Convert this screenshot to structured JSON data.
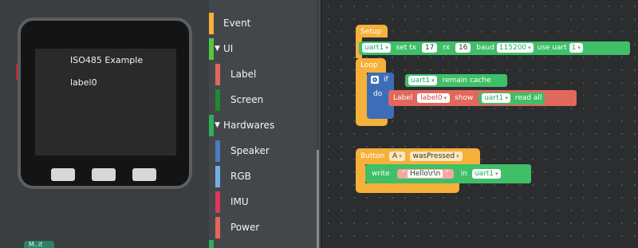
{
  "device": {
    "screen_title": "ISO485 Example",
    "screen_label": "label0",
    "partial_tab_label": "M..it"
  },
  "menu": {
    "items": [
      {
        "label": "Event",
        "color": "#f6b13a"
      },
      {
        "label": "UI",
        "color": "#55c83d",
        "expanded": true
      },
      {
        "label": "Label",
        "color": "#e2685c"
      },
      {
        "label": "Screen",
        "color": "#1f8a2f"
      },
      {
        "label": "Hardwares",
        "color": "#2fae5a",
        "expanded": true
      },
      {
        "label": "Speaker",
        "color": "#4f7ac4"
      },
      {
        "label": "RGB",
        "color": "#6fb1e6"
      },
      {
        "label": "IMU",
        "color": "#e0365f"
      },
      {
        "label": "Power",
        "color": "#e2685c"
      }
    ],
    "expand_glyph": "▼"
  },
  "workspace": {
    "setup": {
      "header": "Setup",
      "uart_var": "uart1",
      "set_tx": "set tx",
      "tx": "17",
      "rx_label": "rx",
      "rx": "16",
      "baud_label": "baud",
      "baud": "115200",
      "use_uart": "use uart",
      "uart_num": "1"
    },
    "loop": {
      "header": "Loop",
      "if_label": "if",
      "uart_var": "uart1",
      "remain_cache": "remain cache",
      "do_label": "do",
      "label_kw": "Label",
      "label_var": "label0",
      "show": "show",
      "uart_var2": "uart1",
      "read_all": "read all"
    },
    "button": {
      "header": "Button",
      "btn": "A",
      "event": "wasPressed",
      "write": "write",
      "string": "Hello\\r\\n",
      "in": "in",
      "uart_var": "uart1"
    }
  }
}
